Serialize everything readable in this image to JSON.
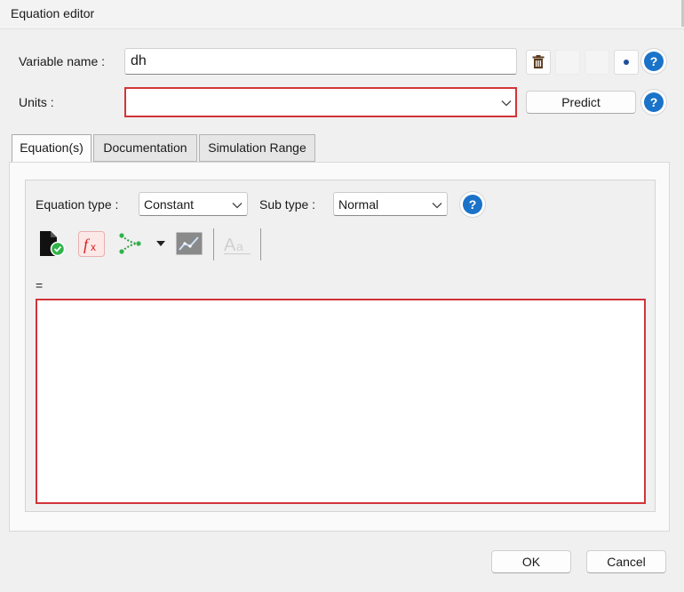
{
  "window": {
    "title": "Equation editor"
  },
  "variable": {
    "label": "Variable name :",
    "value": "dh"
  },
  "units": {
    "label": "Units :",
    "value": "",
    "predict_label": "Predict"
  },
  "tabs": [
    {
      "label": "Equation(s)",
      "active": true
    },
    {
      "label": "Documentation",
      "active": false
    },
    {
      "label": "Simulation Range",
      "active": false
    }
  ],
  "equation": {
    "type_label": "Equation type :",
    "type_value": "Constant",
    "subtype_label": "Sub type :",
    "subtype_value": "Normal",
    "equals_sign": "=",
    "text": ""
  },
  "toolbar": {
    "icons": [
      "validate-file-icon",
      "function-icon",
      "branch-icon",
      "dropdown-arrow-icon",
      "graph-icon",
      "text-format-icon"
    ]
  },
  "help_glyph": "?",
  "footer": {
    "ok_label": "OK",
    "cancel_label": "Cancel"
  },
  "colors": {
    "error_border": "#d13438",
    "help_blue": "#1a73c8"
  }
}
